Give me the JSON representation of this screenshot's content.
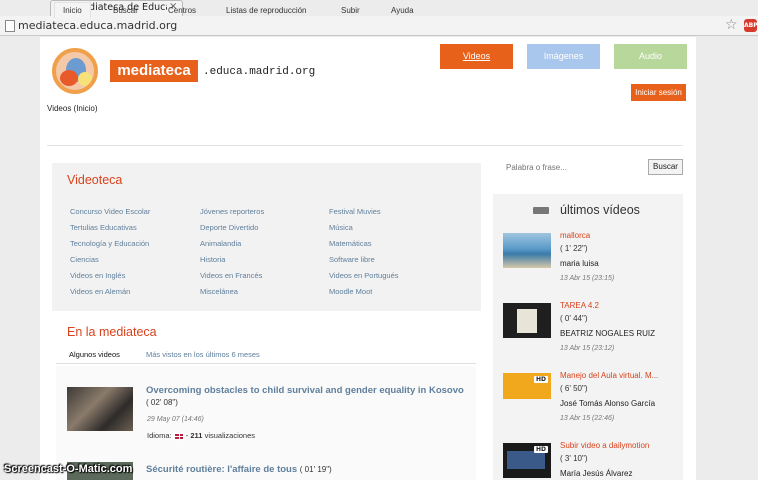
{
  "browser": {
    "tab_title": "Mediateca de EducaMadrid",
    "tab_close": "×",
    "url": "mediateca.educa.madrid.org",
    "star": "☆",
    "abp": "ABP"
  },
  "header": {
    "logo_text": "mediateca",
    "logo_domain": ".educa.madrid.org",
    "media_buttons": {
      "videos": "Videos",
      "imagenes": "Imágenes",
      "audio": "Audio"
    },
    "login": "Iniciar sesión",
    "breadcrumb": "Videos (Inicio)"
  },
  "nav": {
    "items": [
      "Inicio",
      "Buscar",
      "Centros",
      "Listas de reproducción",
      "Subir",
      "Ayuda"
    ]
  },
  "search": {
    "placeholder": "Palabra o frase...",
    "button": "Buscar"
  },
  "videoteca": {
    "title": "Videoteca",
    "col1": [
      "Concurso Video Escolar",
      "Tertulias Educativas",
      "Tecnología y Educación",
      "Ciencias",
      "Videos en Inglés",
      "Videos en Alemán"
    ],
    "col2": [
      "Jóvenes reporteros",
      "Deporte Divertido",
      "Animalandia",
      "Historia",
      "Videos en Francés",
      "Miscelánea"
    ],
    "col3": [
      "Festival Muvies",
      "Música",
      "Matemáticas",
      "Software libre",
      "Videos en Portugués",
      "Moodle Moot"
    ]
  },
  "mediateca": {
    "title": "En la mediateca",
    "tab_1": "Algunos videos",
    "tab_2": "Más vistos en los últimos 6 meses",
    "items": [
      {
        "title": "Overcoming obstacles to child survival and gender equality in Kosovo",
        "duration": "( 02' 08\")",
        "date": "29 May 07 (14:46)",
        "lang_label": "Idioma:",
        "views": "211",
        "views_label": "visualizaciones"
      },
      {
        "title": "Sécurité routière: l'affaire de tous",
        "duration": "( 01' 19\")"
      }
    ]
  },
  "sidebar": {
    "title": "últimos vídeos",
    "items": [
      {
        "title": "mallorca",
        "duration": "( 1' 22\")",
        "author": "maria luisa",
        "date": "13 Abr 15 (23:15)",
        "color": "#4a8fb5"
      },
      {
        "title": "TAREA 4.2",
        "duration": "( 0' 44\")",
        "author": "BEATRIZ NOGALES RUIZ",
        "date": "13 Abr 15 (23:12)",
        "color": "#1f1f1f"
      },
      {
        "title": "Manejo del Aula virtual. M...",
        "duration": "( 6' 50\")",
        "author": "José Tomás Alonso García",
        "date": "13 Abr 15 (22:46)",
        "color": "#f2a81d"
      },
      {
        "title": "Subir video a dailymotion",
        "duration": "( 3' 10\")",
        "author": "María Jesús Álvarez",
        "date": "",
        "color": "#1a1a1a"
      }
    ]
  },
  "overlay": {
    "watermark": "Screencast-O-Matic.com"
  },
  "colors": {
    "accent": "#e8611b",
    "link": "#5f7f9c",
    "heading": "#d8421c"
  }
}
